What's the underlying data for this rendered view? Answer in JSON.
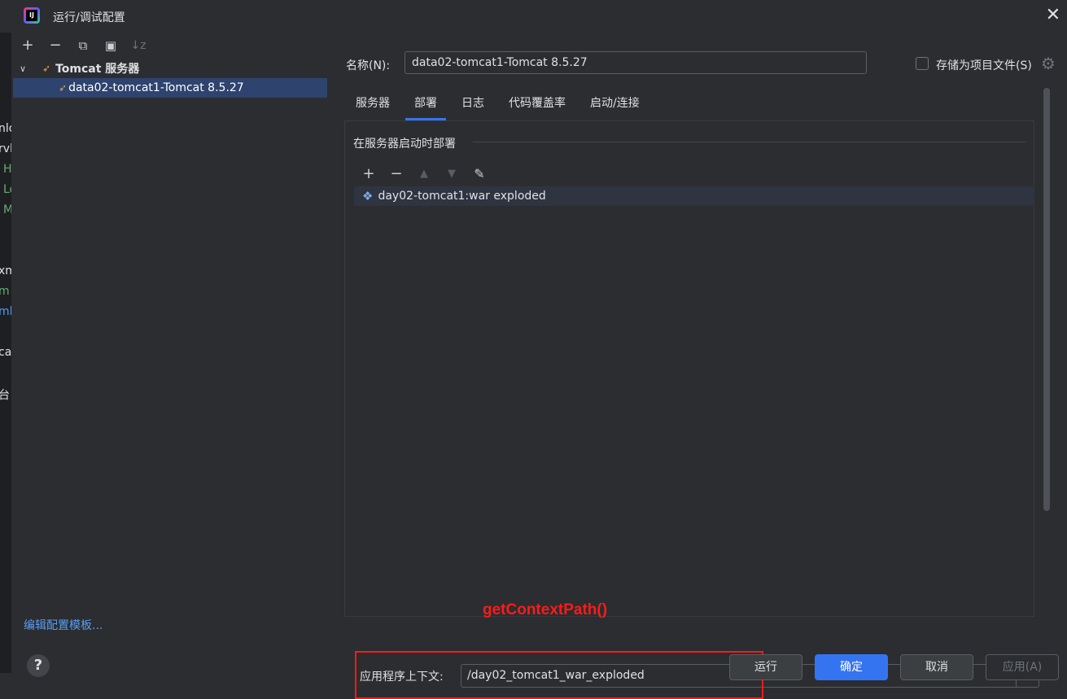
{
  "window": {
    "title": "运行/调试配置",
    "close": "✕"
  },
  "background_strip": [
    "nlo",
    "rvl",
    "H",
    "Lo",
    "M",
    "xm",
    "m",
    "ml",
    "cat",
    "台"
  ],
  "left_toolbar": {
    "add": "+",
    "remove": "−",
    "copy": "⧉",
    "new_folder": "▣",
    "sort": "↓z"
  },
  "tree": {
    "group_chevron": "∨",
    "group_label": "Tomcat 服务器",
    "items": [
      {
        "label": "data02-tomcat1-Tomcat 8.5.27"
      }
    ]
  },
  "edit_templates": "编辑配置模板...",
  "help": "?",
  "name": {
    "label": "名称(N):",
    "value": "data02-tomcat1-Tomcat 8.5.27"
  },
  "store_as_project": {
    "label": "存储为项目文件(S)",
    "checked": false
  },
  "tabs": [
    {
      "label": "服务器",
      "active": false
    },
    {
      "label": "部署",
      "active": true
    },
    {
      "label": "日志",
      "active": false
    },
    {
      "label": "代码覆盖率",
      "active": false
    },
    {
      "label": "启动/连接",
      "active": false
    }
  ],
  "deploy": {
    "section_title": "在服务器启动时部署",
    "toolbar": {
      "add": "+",
      "remove": "−",
      "up": "▲",
      "down": "▼",
      "edit": "✎"
    },
    "artifacts": [
      "day02-tomcat1:war exploded"
    ]
  },
  "annotation": {
    "text": "getContextPath()",
    "color": "#ff1a1a"
  },
  "app_context": {
    "label": "应用程序上下文:",
    "value": "/day02_tomcat1_war_exploded",
    "dropdown": "▼"
  },
  "buttons": {
    "run": "运行",
    "ok": "确定",
    "cancel": "取消",
    "apply": "应用(A)"
  },
  "colors": {
    "accent": "#3574f0",
    "selection": "#2e436e",
    "background": "#2b2d30"
  }
}
